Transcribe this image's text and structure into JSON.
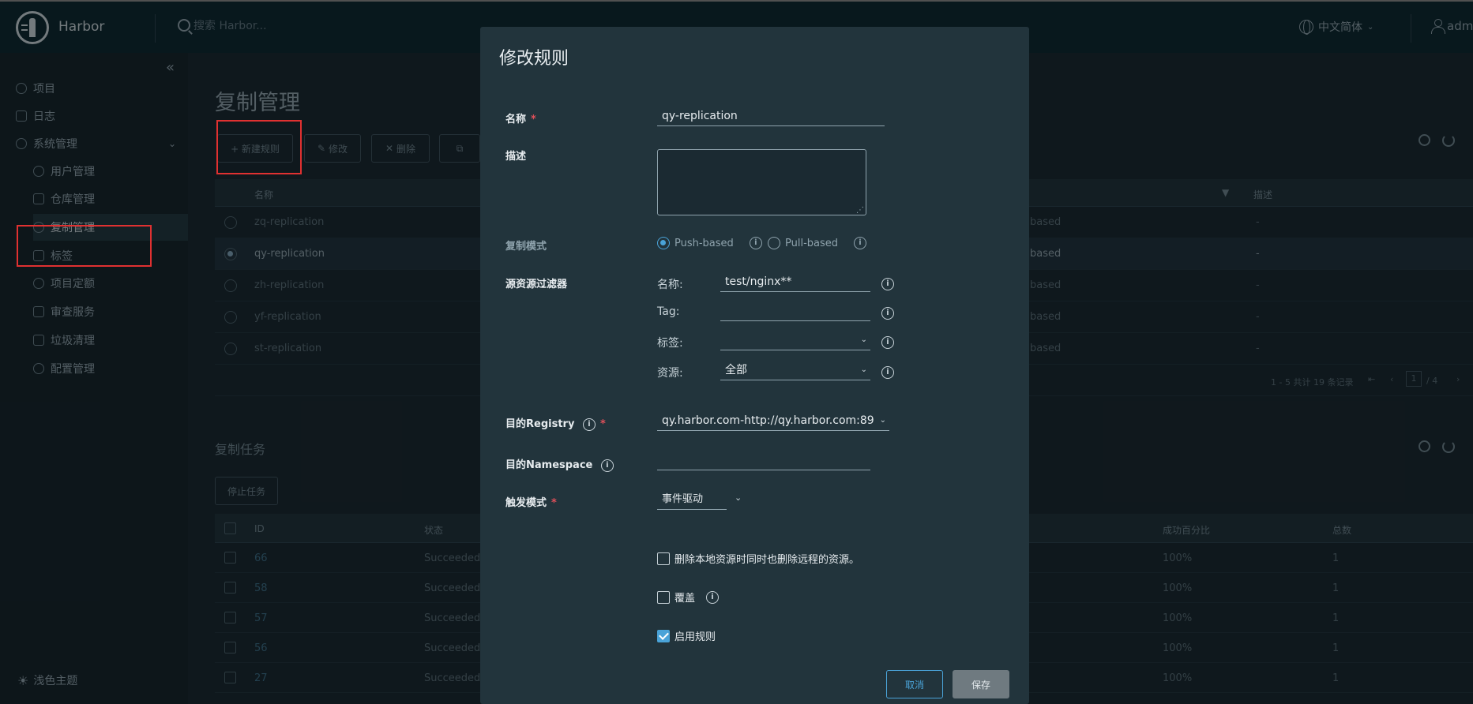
{
  "header": {
    "brand": "Harbor",
    "search_placeholder": "搜索 Harbor...",
    "language": "中文简体",
    "user": "adm"
  },
  "sidebar": {
    "items": [
      {
        "label": "项目",
        "icon": "project-icon"
      },
      {
        "label": "日志",
        "icon": "log-icon"
      },
      {
        "label": "系统管理",
        "icon": "admin-icon"
      },
      {
        "label": "用户管理",
        "icon": "users-icon"
      },
      {
        "label": "仓库管理",
        "icon": "registry-icon"
      },
      {
        "label": "复制管理",
        "icon": "replication-icon"
      },
      {
        "label": "标签",
        "icon": "tag-icon"
      },
      {
        "label": "项目定额",
        "icon": "quota-icon"
      },
      {
        "label": "审查服务",
        "icon": "shield-icon"
      },
      {
        "label": "垃圾清理",
        "icon": "trash-icon"
      },
      {
        "label": "配置管理",
        "icon": "gear-icon"
      }
    ],
    "theme_label": "浅色主题"
  },
  "main": {
    "title": "复制管理",
    "toolbar": {
      "new_rule": "+ 新建规则",
      "edit": "修改",
      "delete": "删除",
      "copy": "复制"
    },
    "rules_table": {
      "columns": [
        "名称",
        "描述"
      ],
      "rows": [
        {
          "name": "zq-replication",
          "mode": "based",
          "desc": "-"
        },
        {
          "name": "qy-replication",
          "mode": "based",
          "desc": "-"
        },
        {
          "name": "zh-replication",
          "mode": "based",
          "desc": "-"
        },
        {
          "name": "yf-replication",
          "mode": "based",
          "desc": "-"
        },
        {
          "name": "st-replication",
          "mode": "based",
          "desc": "-"
        }
      ],
      "pagination": "1 - 5 共计 19 条记录",
      "page_current": "1",
      "page_total": "/ 4"
    },
    "tasks": {
      "title": "复制任务",
      "stop_button": "停止任务",
      "columns": [
        "ID",
        "状态",
        "成功百分比",
        "总数"
      ],
      "rows": [
        {
          "id": "66",
          "status": "Succeeded",
          "pct": "100%",
          "total": "1"
        },
        {
          "id": "58",
          "status": "Succeeded",
          "pct": "100%",
          "total": "1"
        },
        {
          "id": "57",
          "status": "Succeeded",
          "pct": "100%",
          "total": "1"
        },
        {
          "id": "56",
          "status": "Succeeded",
          "pct": "100%",
          "total": "1"
        },
        {
          "id": "27",
          "status": "Succeeded",
          "pct": "100%",
          "total": "1"
        }
      ]
    }
  },
  "modal": {
    "title": "修改规则",
    "name_label": "名称",
    "name_value": "qy-replication",
    "desc_label": "描述",
    "mode_label": "复制模式",
    "mode_push": "Push-based",
    "mode_pull": "Pull-based",
    "filter_label": "源资源过滤器",
    "filter_name_label": "名称:",
    "filter_name_value": "test/nginx**",
    "filter_tag_label": "Tag:",
    "filter_tag_value": "",
    "filter_label_label": "标签:",
    "filter_label_value": "",
    "filter_resource_label": "资源:",
    "filter_resource_value": "全部",
    "registry_label": "目的Registry",
    "registry_value": "qy.harbor.com-http://qy.harbor.com:89",
    "namespace_label": "目的Namespace",
    "namespace_value": "",
    "trigger_label": "触发模式",
    "trigger_value": "事件驱动",
    "delete_remote_label": "删除本地资源时同时也删除远程的资源。",
    "override_label": "覆盖",
    "enable_label": "启用规则",
    "cancel": "取消",
    "save": "保存",
    "accent": "#4aa3d8"
  }
}
